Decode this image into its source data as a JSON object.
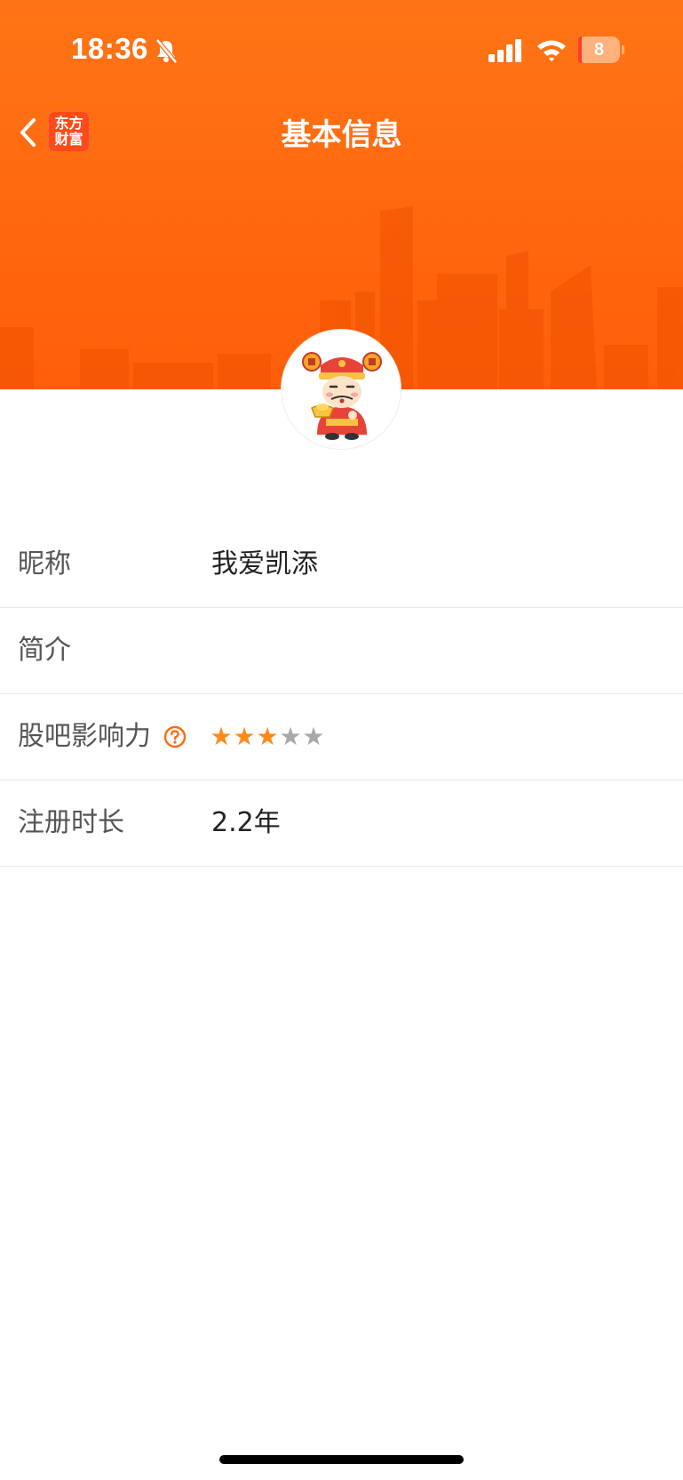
{
  "theme": {
    "accent": "#ff6a10",
    "logo_bg": "#ff4a1a",
    "star_on": "#ff8a1a",
    "star_off": "#a8a8a8",
    "help": "#ff6a10"
  },
  "status_bar": {
    "time": "18:36",
    "silent_icon": "bell-slash-icon",
    "battery_level": "8",
    "battery_fraction": 0.08
  },
  "nav": {
    "back_icon": "chevron-left-icon",
    "logo_line1": "东方",
    "logo_line2": "财富",
    "title": "基本信息"
  },
  "profile": {
    "avatar_icon": "god-of-wealth-avatar"
  },
  "rows": [
    {
      "label": "昵称",
      "value": "我爱凯添"
    },
    {
      "label": "简介",
      "value": ""
    },
    {
      "label": "股吧影响力",
      "help_icon": "question-circle-icon",
      "rating": 3,
      "rating_max": 5,
      "star_glyph": "★"
    },
    {
      "label": "注册时长",
      "value": "2.2年"
    }
  ]
}
